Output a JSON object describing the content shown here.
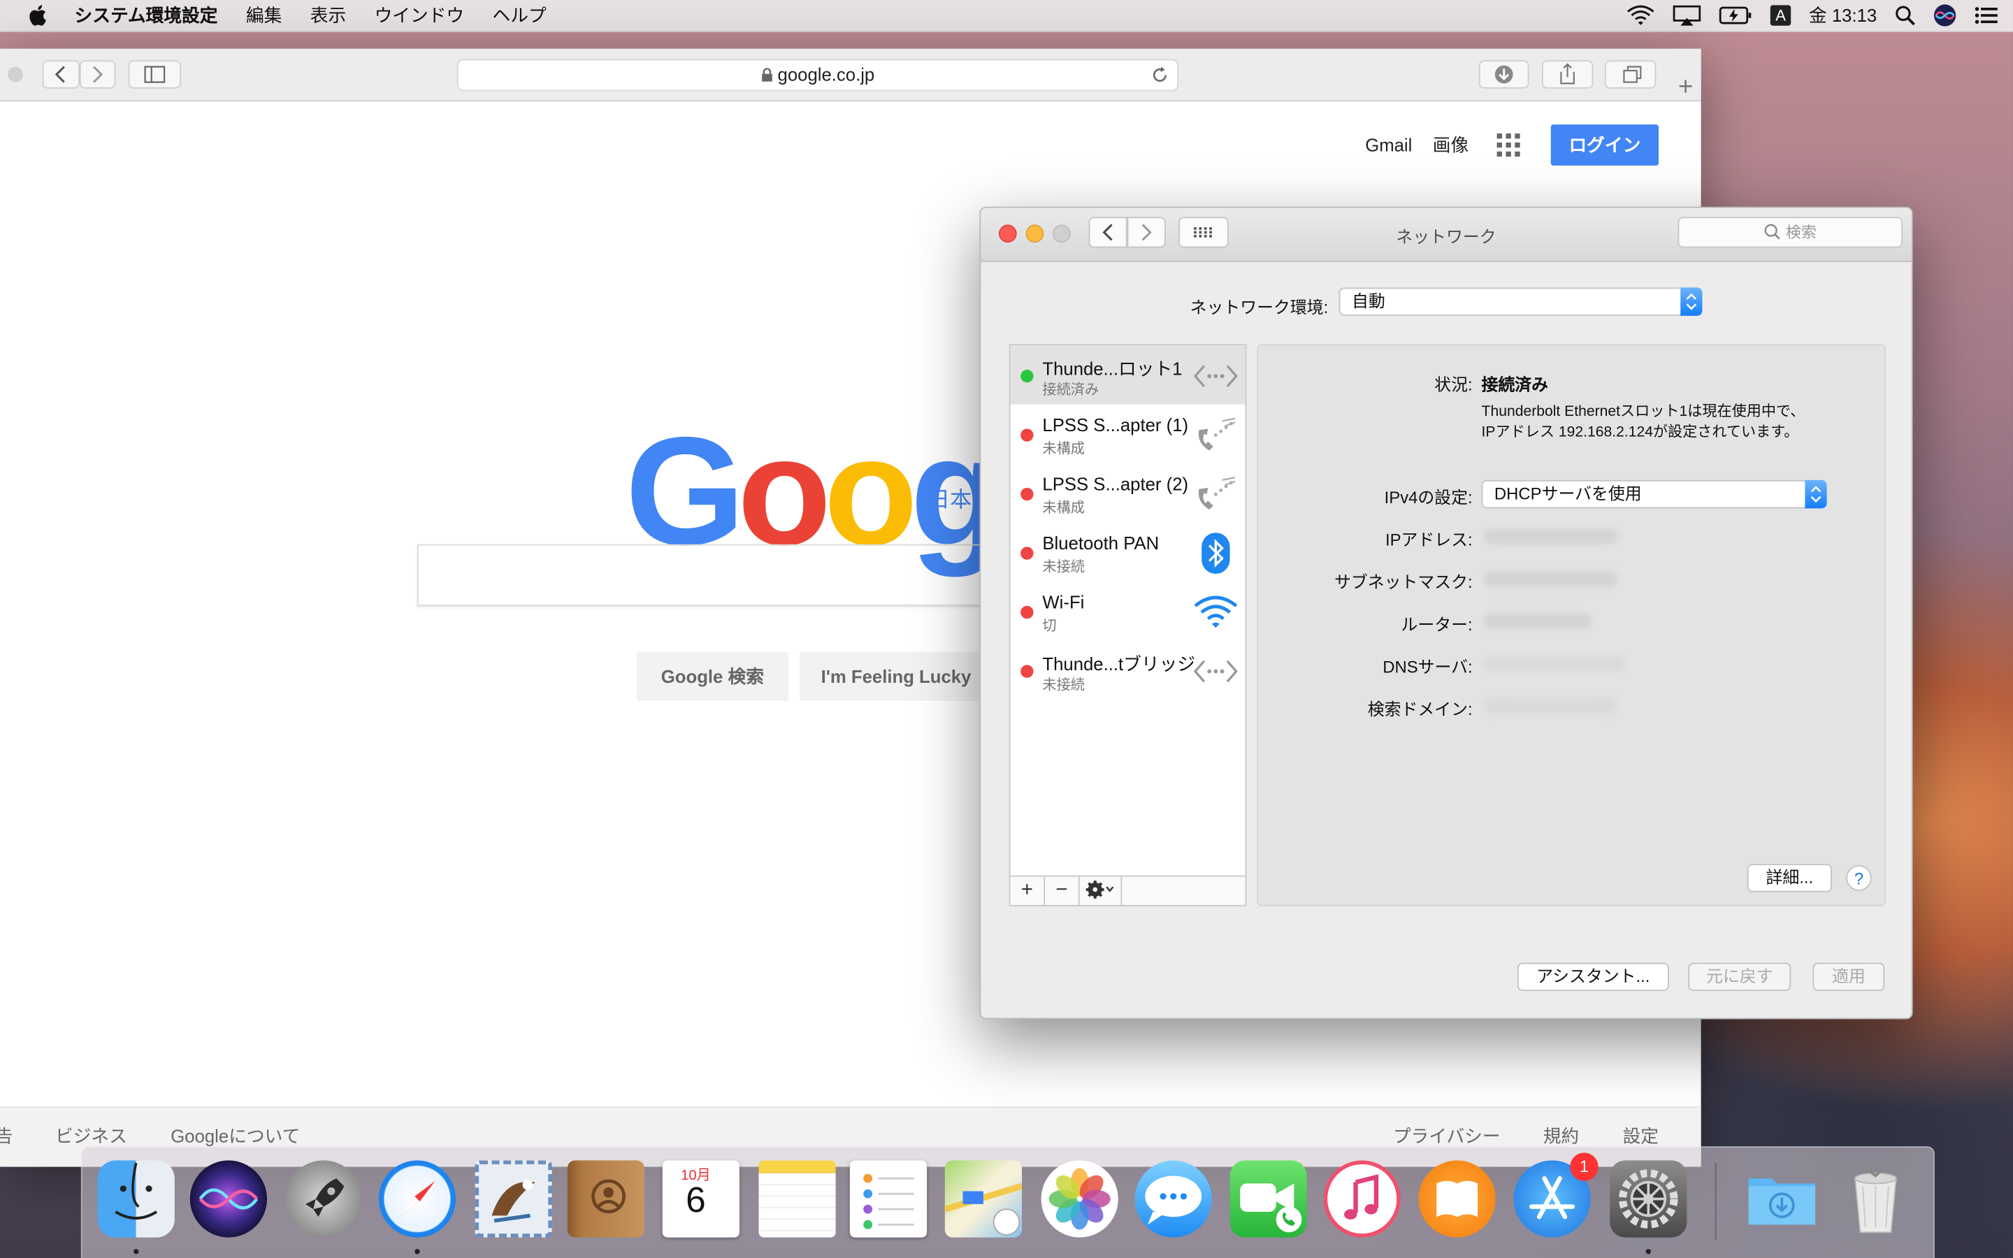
{
  "menubar": {
    "app_name": "システム環境設定",
    "items": [
      "編集",
      "表示",
      "ウインドウ",
      "ヘルプ"
    ],
    "clock": "金 13:13",
    "input_source": "A"
  },
  "safari": {
    "url": "google.co.jp",
    "header": {
      "gmail": "Gmail",
      "images": "画像",
      "login": "ログイン"
    },
    "logo_sub": "日本",
    "search_button": "Google 検索",
    "lucky_button": "I'm Feeling Lucky",
    "footer_left": [
      "告",
      "ビジネス",
      "Googleについて"
    ],
    "footer_right": [
      "プライバシー",
      "規約",
      "設定"
    ]
  },
  "network": {
    "title": "ネットワーク",
    "search_placeholder": "検索",
    "location_label": "ネットワーク環境:",
    "location_value": "自動",
    "services": [
      {
        "name": "Thunde...ロット1",
        "status": "接続済み",
        "connected": true,
        "icon": "ethernet-icon"
      },
      {
        "name": "LPSS S...apter (1)",
        "status": "未構成",
        "connected": false,
        "icon": "phone-icon"
      },
      {
        "name": "LPSS S...apter (2)",
        "status": "未構成",
        "connected": false,
        "icon": "phone-icon"
      },
      {
        "name": "Bluetooth PAN",
        "status": "未接続",
        "connected": false,
        "icon": "bluetooth-icon"
      },
      {
        "name": "Wi-Fi",
        "status": "切",
        "connected": false,
        "icon": "wifi-icon"
      },
      {
        "name": "Thunde...tブリッジ",
        "status": "未接続",
        "connected": false,
        "icon": "ethernet-icon"
      }
    ],
    "list_buttons": {
      "add": "+",
      "remove": "−"
    },
    "status_label": "状況:",
    "status_value": "接続済み",
    "status_desc_1": "Thunderbolt Ethernetスロット1は現在使用中で、",
    "status_desc_2": "IPアドレス 192.168.2.124が設定されています。",
    "ipv4_label": "IPv4の設定:",
    "ipv4_value": "DHCPサーバを使用",
    "ip_label": "IPアドレス:",
    "subnet_label": "サブネットマスク:",
    "router_label": "ルーター:",
    "dns_label": "DNSサーバ:",
    "domain_label": "検索ドメイン:",
    "advanced_button": "詳細...",
    "help_button": "?",
    "assistant_button": "アシスタント...",
    "revert_button": "元に戻す",
    "apply_button": "適用"
  },
  "dock": {
    "calendar_month": "10月",
    "calendar_day": "6",
    "appstore_badge": "1"
  },
  "colors": {
    "accent_blue": "#4285f4",
    "status_green": "#29c73f",
    "status_red": "#f04343"
  }
}
